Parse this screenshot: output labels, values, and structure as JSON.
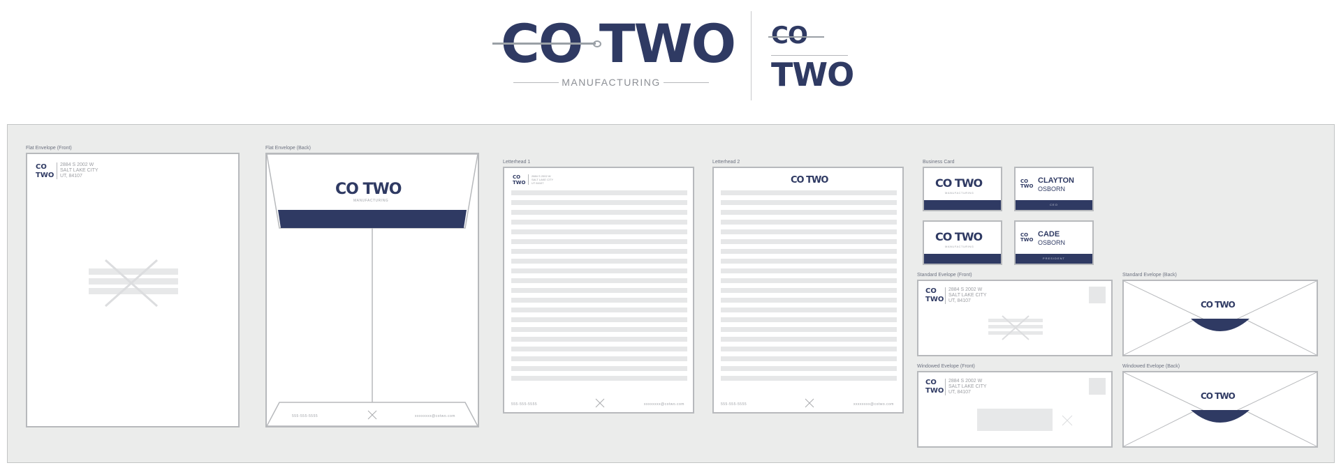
{
  "header": {
    "wordmark": "CO TWO",
    "tagline": "MANUFACTURING",
    "stack_top": "CO",
    "stack_bottom": "TWO"
  },
  "items": {
    "flat_front": {
      "caption": "Flat Envelope (Front)",
      "logo_top": "CO",
      "logo_bottom": "TWO",
      "address": [
        "2884 S 2002 W",
        "SALT LAKE CITY",
        "UT, 84107"
      ]
    },
    "flat_back": {
      "caption": "Flat Envelope (Back)",
      "wordmark": "CO TWO",
      "tagline": "MANUFACTURING",
      "phone": "555-555-5555",
      "email": "xxxxxxxx@cotwo.com"
    },
    "letterhead1": {
      "caption": "Letterhead 1",
      "logo_top": "CO",
      "logo_bottom": "TWO",
      "address": [
        "2884 S 2002 W",
        "SALT LAKE CITY",
        "UT 84107"
      ],
      "phone": "555-555-5555",
      "email": "xxxxxxxx@cotwo.com"
    },
    "letterhead2": {
      "caption": "Letterhead 2",
      "wordmark": "CO TWO",
      "phone": "555-555-5555",
      "email": "xxxxxxxx@cotwo.com"
    },
    "business_cards": {
      "caption": "Business Card",
      "front_wordmark": "CO TWO",
      "front_tagline": "MANUFACTURING",
      "cards": [
        {
          "first": "CLAYTON",
          "last": "OSBORN",
          "title": "CEO"
        },
        {
          "first": "CADE",
          "last": "OSBORN",
          "title": "PRESIDENT"
        }
      ],
      "logo_top": "CO",
      "logo_bottom": "TWO"
    },
    "std_front": {
      "caption": "Standard Evelope (Front)",
      "logo_top": "CO",
      "logo_bottom": "TWO",
      "address": [
        "2884 S 2002 W",
        "SALT LAKE CITY",
        "UT, 84107"
      ]
    },
    "std_back": {
      "caption": "Standard Evelope (Back)",
      "wordmark": "CO TWO"
    },
    "win_front": {
      "caption": "Windowed Evelope (Front)",
      "logo_top": "CO",
      "logo_bottom": "TWO",
      "address": [
        "2884 S 2002 W",
        "SALT LAKE CITY",
        "UT, 84107"
      ]
    },
    "win_back": {
      "caption": "Windowed Evelope (Back)",
      "wordmark": "CO TWO"
    }
  },
  "colors": {
    "navy": "#2f3a63",
    "gray": "#ebeceb"
  }
}
